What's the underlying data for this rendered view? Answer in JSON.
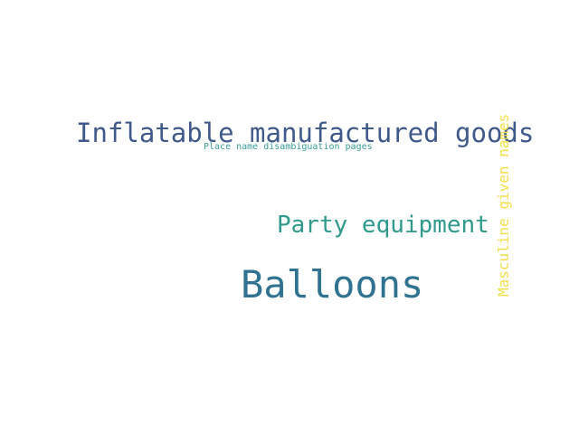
{
  "words": {
    "inflatable": {
      "text": "Inflatable manufactured goods",
      "color": "#3f5a8a"
    },
    "place": {
      "text": "Place name disambiguation pages",
      "color": "#3a9a9a"
    },
    "party": {
      "text": "Party equipment",
      "color": "#2f9a8c"
    },
    "balloons": {
      "text": "Balloons",
      "color": "#2f7390"
    },
    "masculine": {
      "text": "Masculine given names",
      "color": "#f2df4a"
    }
  }
}
